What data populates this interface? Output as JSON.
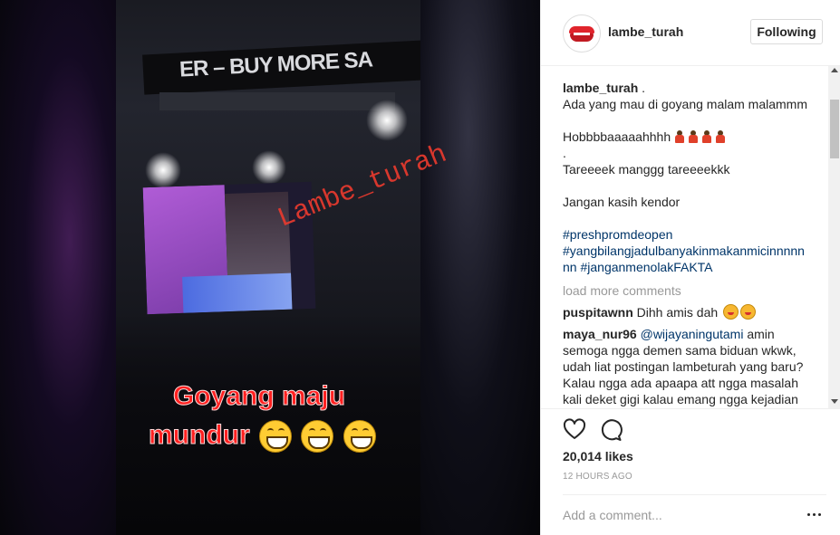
{
  "media": {
    "stage_text": "ER – BUY MORE SA",
    "watermark": "Lambe_turah",
    "caption_line1": "Goyang maju",
    "caption_line2": "mundur",
    "caption_emojis": [
      "grinning-face-emoji",
      "grinning-face-emoji",
      "grinning-face-emoji"
    ]
  },
  "post": {
    "username": "lambe_turah",
    "follow_label": "Following",
    "caption": {
      "author": "lambe_turah",
      "first_line": " .",
      "lines": [
        "Ada yang mau di goyang malam malammm",
        "Hobbbbaaaaahhhh",
        ".",
        "Tareeeek manggg tareeeekkk",
        "Jangan kasih kendor"
      ],
      "runner_emoji_count": 4,
      "hashtags": [
        "#preshpromdeopen",
        "#yangbilangjadulbanyakinmakanmicinnnnn",
        "nn",
        "#janganmenolakFAKTA"
      ]
    },
    "load_more": "load more comments",
    "comments": [
      {
        "user": "puspitawnn",
        "text": "Dihh amis dah"
      },
      {
        "user": "maya_nur96",
        "mention": "@wijayaningutami",
        "text_first": " amin",
        "lines": [
          "semoga ngga demen sama biduan wkwk,",
          "udah liat postingan lambeturah yang baru?",
          "Kalau ngga ada apaapa att ngga masalah",
          "kali deket gigi kalau emang ngga kejadian"
        ]
      }
    ],
    "likes": "20,014 likes",
    "timestamp": "12 HOURS AGO",
    "add_comment_placeholder": "Add a comment...",
    "icons": {
      "like": "heart-icon",
      "comment": "comment-icon",
      "more": "more-options-icon"
    }
  }
}
